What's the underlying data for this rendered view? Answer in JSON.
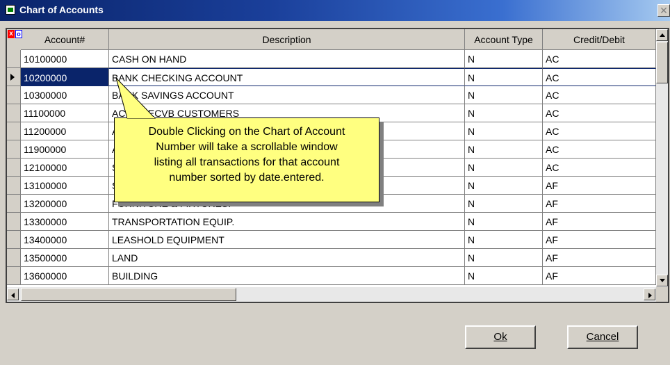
{
  "window": {
    "title": "Chart of Accounts",
    "close_glyph": "✕"
  },
  "grid": {
    "row_buttons": {
      "x_label": "x",
      "o_label": "o"
    },
    "columns": [
      "Account#",
      "Description",
      "Account Type",
      "Credit/Debit"
    ],
    "rows": [
      {
        "account": "10100000",
        "description": "CASH ON HAND",
        "type": "N",
        "cd": "AC"
      },
      {
        "account": "10200000",
        "description": "BANK CHECKING ACCOUNT",
        "type": "N",
        "cd": "AC"
      },
      {
        "account": "10300000",
        "description": "BANK SAVINGS ACCOUNT",
        "type": "N",
        "cd": "AC"
      },
      {
        "account": "11100000",
        "description": "ACCT RECVB CUSTOMERS",
        "type": "N",
        "cd": "AC"
      },
      {
        "account": "11200000",
        "description": "A",
        "type": "N",
        "cd": "AC"
      },
      {
        "account": "11900000",
        "description": "A",
        "type": "N",
        "cd": "AC"
      },
      {
        "account": "12100000",
        "description": "S",
        "type": "N",
        "cd": "AC"
      },
      {
        "account": "13100000",
        "description": "S",
        "type": "N",
        "cd": "AF"
      },
      {
        "account": "13200000",
        "description": "FURNITURE & FIXTURES.",
        "type": "N",
        "cd": "AF"
      },
      {
        "account": "13300000",
        "description": "TRANSPORTATION EQUIP.",
        "type": "N",
        "cd": "AF"
      },
      {
        "account": "13400000",
        "description": "LEASHOLD EQUIPMENT",
        "type": "N",
        "cd": "AF"
      },
      {
        "account": "13500000",
        "description": "LAND",
        "type": "N",
        "cd": "AF"
      },
      {
        "account": "13600000",
        "description": "BUILDING",
        "type": "N",
        "cd": "AF"
      }
    ],
    "current_row_index": 1
  },
  "tooltip": {
    "lines": [
      "Double Clicking on the Chart of Account",
      "Number will take a scrollable window",
      "listing all transactions for that account",
      "number sorted by date.entered."
    ]
  },
  "buttons": {
    "ok_label": "Ok",
    "cancel_label": "Cancel"
  },
  "colors": {
    "title_bar": "#0a246a",
    "selection": "#0a246a",
    "tooltip_bg": "#ffff80"
  }
}
